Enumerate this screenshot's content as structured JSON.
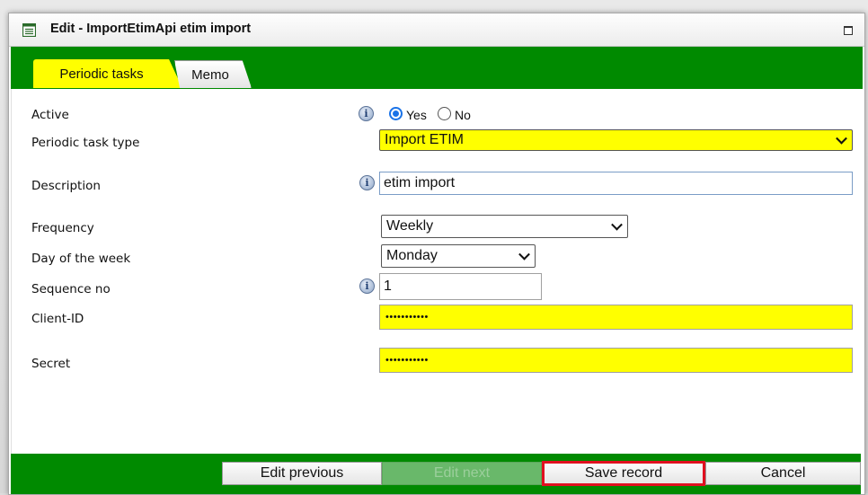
{
  "window": {
    "title": "Edit - ImportEtimApi etim import"
  },
  "tabs": [
    {
      "label": "Periodic tasks",
      "active": true
    },
    {
      "label": "Memo",
      "active": false
    }
  ],
  "form": {
    "active": {
      "label": "Active",
      "options": [
        "Yes",
        "No"
      ],
      "selected": "Yes"
    },
    "task_type": {
      "label": "Periodic task type",
      "value": "Import ETIM"
    },
    "description": {
      "label": "Description",
      "value": "etim import"
    },
    "frequency": {
      "label": "Frequency",
      "value": "Weekly"
    },
    "day_of_week": {
      "label": "Day of the week",
      "value": "Monday"
    },
    "sequence_no": {
      "label": "Sequence no",
      "value": "1"
    },
    "client_id": {
      "label": "Client-ID",
      "value": "•••••••••••"
    },
    "secret": {
      "label": "Secret",
      "value": "•••••••••••"
    }
  },
  "footer": {
    "edit_previous": "Edit previous",
    "edit_next": "Edit next",
    "save_record": "Save record",
    "cancel": "Cancel"
  },
  "colors": {
    "accent_green": "#008a00",
    "required_yellow": "#ffff00",
    "highlight_red": "#e01020"
  },
  "icons": [
    "form-icon",
    "maximize-icon",
    "info-icon",
    "chevron-down-icon"
  ]
}
